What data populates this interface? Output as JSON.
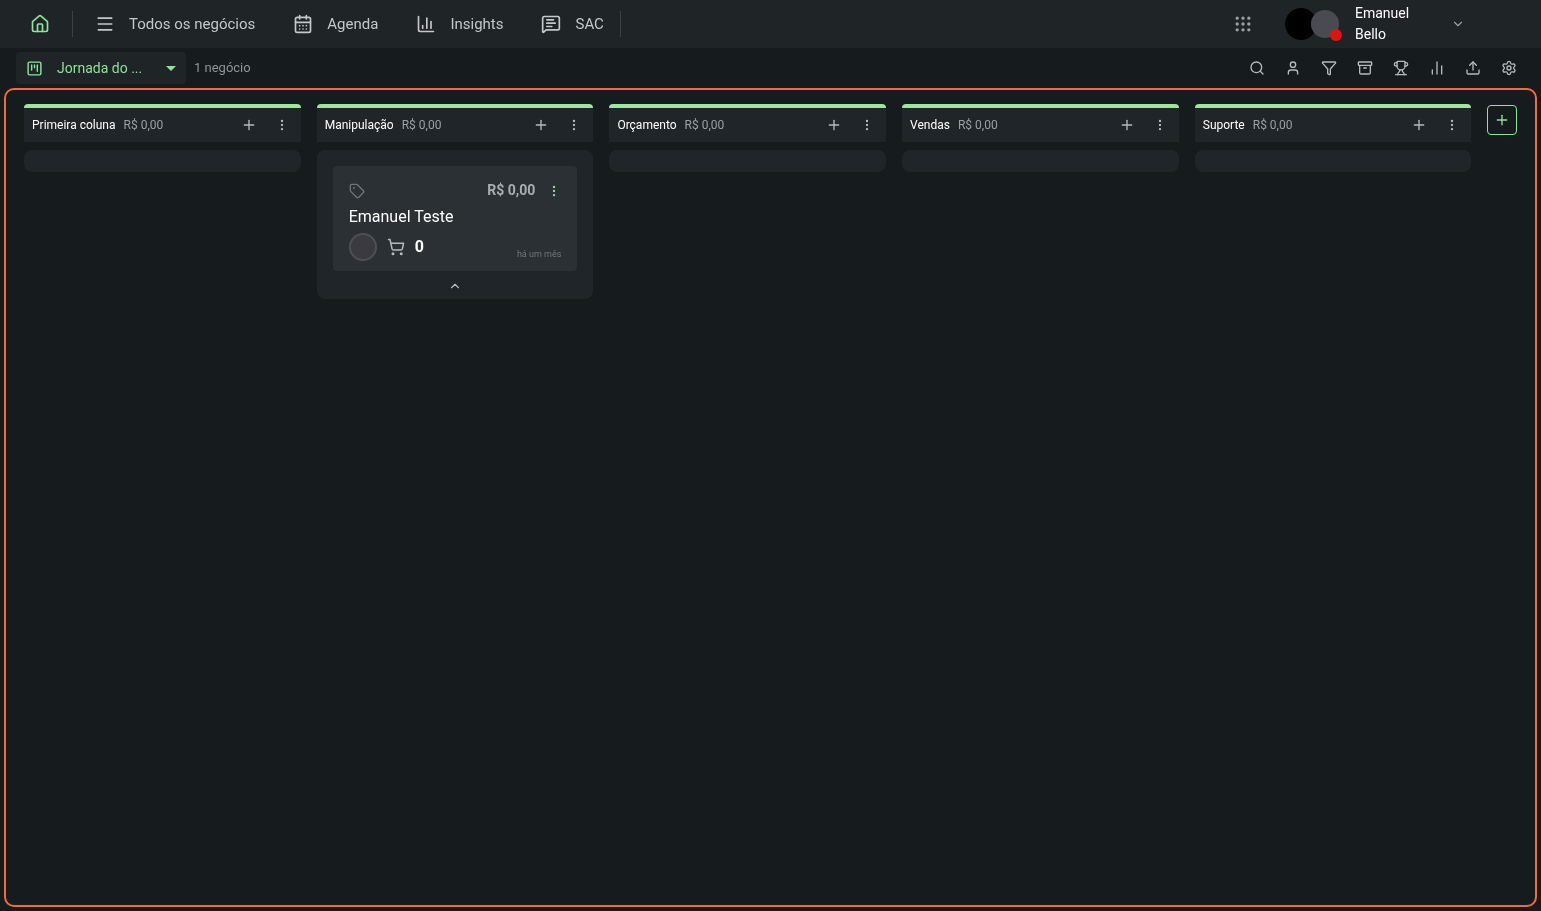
{
  "nav": [
    {
      "kind": "list",
      "label": "Todos os negócios"
    },
    {
      "kind": "calendar",
      "label": "Agenda"
    },
    {
      "kind": "chart",
      "label": "Insights"
    },
    {
      "kind": "chat",
      "label": "SAC"
    }
  ],
  "user": {
    "first": "Emanuel",
    "last": "Bello",
    "online": false
  },
  "pipeline": {
    "label": "Jornada do ...",
    "count": "1 negócio"
  },
  "columns": [
    {
      "name": "Primeira coluna",
      "total": "R$ 0,00"
    },
    {
      "name": "Manipulação",
      "total": "R$ 0,00",
      "cards": [
        {
          "value": "R$ 0,00",
          "title": "Emanuel Teste",
          "products": "0",
          "time": "há um mês"
        }
      ]
    },
    {
      "name": "Orçamento",
      "total": "R$ 0,00"
    },
    {
      "name": "Vendas",
      "total": "R$ 0,00"
    },
    {
      "name": "Suporte",
      "total": "R$ 0,00"
    }
  ]
}
